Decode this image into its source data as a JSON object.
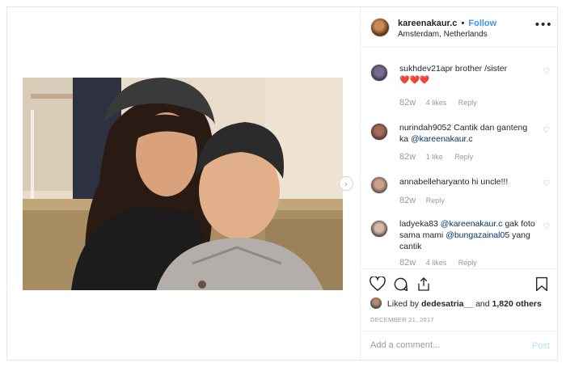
{
  "post": {
    "username": "kareenakaur.c",
    "separator": "•",
    "follow_label": "Follow",
    "location": "Amsterdam, Netherlands",
    "more_icon": "more-horizontal-icon"
  },
  "comments": [
    {
      "username": "sukhdev21apr",
      "text": "brother /sister",
      "hearts": "❤️❤️❤️",
      "age": "82w",
      "likes": "4 likes",
      "reply": "Reply"
    },
    {
      "username": "nurindah9052",
      "text": "Cantik dan ganteng ka",
      "mention": "@kareenakaur.c",
      "age": "82w",
      "likes": "1 like",
      "reply": "Reply"
    },
    {
      "username": "annabelleharyanto",
      "text": "hi uncle!!!",
      "age": "82w",
      "reply": "Reply"
    },
    {
      "username": "ladyeka83",
      "mention": "@kareenakaur.c",
      "text": "gak foto sama mami",
      "mention2": "@bungazainal05",
      "text2": "yang cantik",
      "age": "82w",
      "likes": "4 likes",
      "reply": "Reply"
    }
  ],
  "actions": {
    "liked_prefix": "Liked by",
    "liked_user": "dedesatria__",
    "liked_and": "and",
    "liked_count": "1,820 others",
    "date": "DECEMBER 21, 2017"
  },
  "add_comment": {
    "placeholder": "Add a comment...",
    "post_label": "Post"
  },
  "colors": {
    "link": "#3897f0",
    "mention": "#003569",
    "heart": "#ed4956",
    "muted": "#999999"
  }
}
